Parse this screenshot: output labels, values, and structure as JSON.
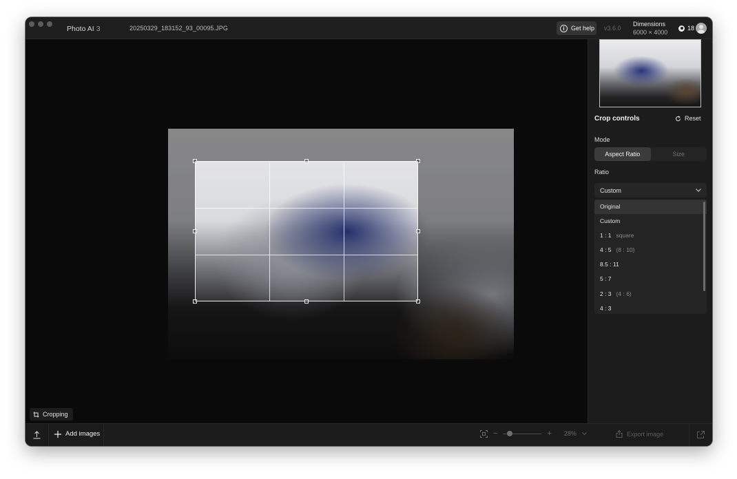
{
  "titlebar": {
    "app_name": "Photo AI",
    "app_version": "3",
    "filename": "20250329_183152_93_00095.JPG",
    "help_label": "Get help",
    "version": "v3.6.0",
    "dimensions_label": "Dimensions",
    "dimensions_value": "6000 × 4000",
    "credits": "18"
  },
  "canvas": {
    "mode_chip": "Cropping"
  },
  "sidebar": {
    "title": "Crop controls",
    "reset_label": "Reset",
    "mode_label": "Mode",
    "modes": [
      "Aspect Ratio",
      "Size"
    ],
    "active_mode": "Aspect Ratio",
    "ratio_label": "Ratio",
    "ratio_selected": "Custom",
    "ratio_options": [
      {
        "label": "Original",
        "hint": ""
      },
      {
        "label": "Custom",
        "hint": ""
      },
      {
        "label": "1 : 1",
        "hint": "square"
      },
      {
        "label": "4 : 5",
        "hint": "(8 : 10)"
      },
      {
        "label": "8.5 : 11",
        "hint": ""
      },
      {
        "label": "5 : 7",
        "hint": ""
      },
      {
        "label": "2 : 3",
        "hint": "(4 : 6)"
      },
      {
        "label": "4 : 3",
        "hint": ""
      }
    ],
    "highlighted_option": "Original"
  },
  "bottombar": {
    "add_images_label": "Add images",
    "zoom_value": "28%",
    "export_label": "Export image"
  },
  "colors": {
    "window_bg": "#0b0b0b",
    "panel_bg": "#1c1c1c",
    "text_primary": "#e8e8e8"
  }
}
